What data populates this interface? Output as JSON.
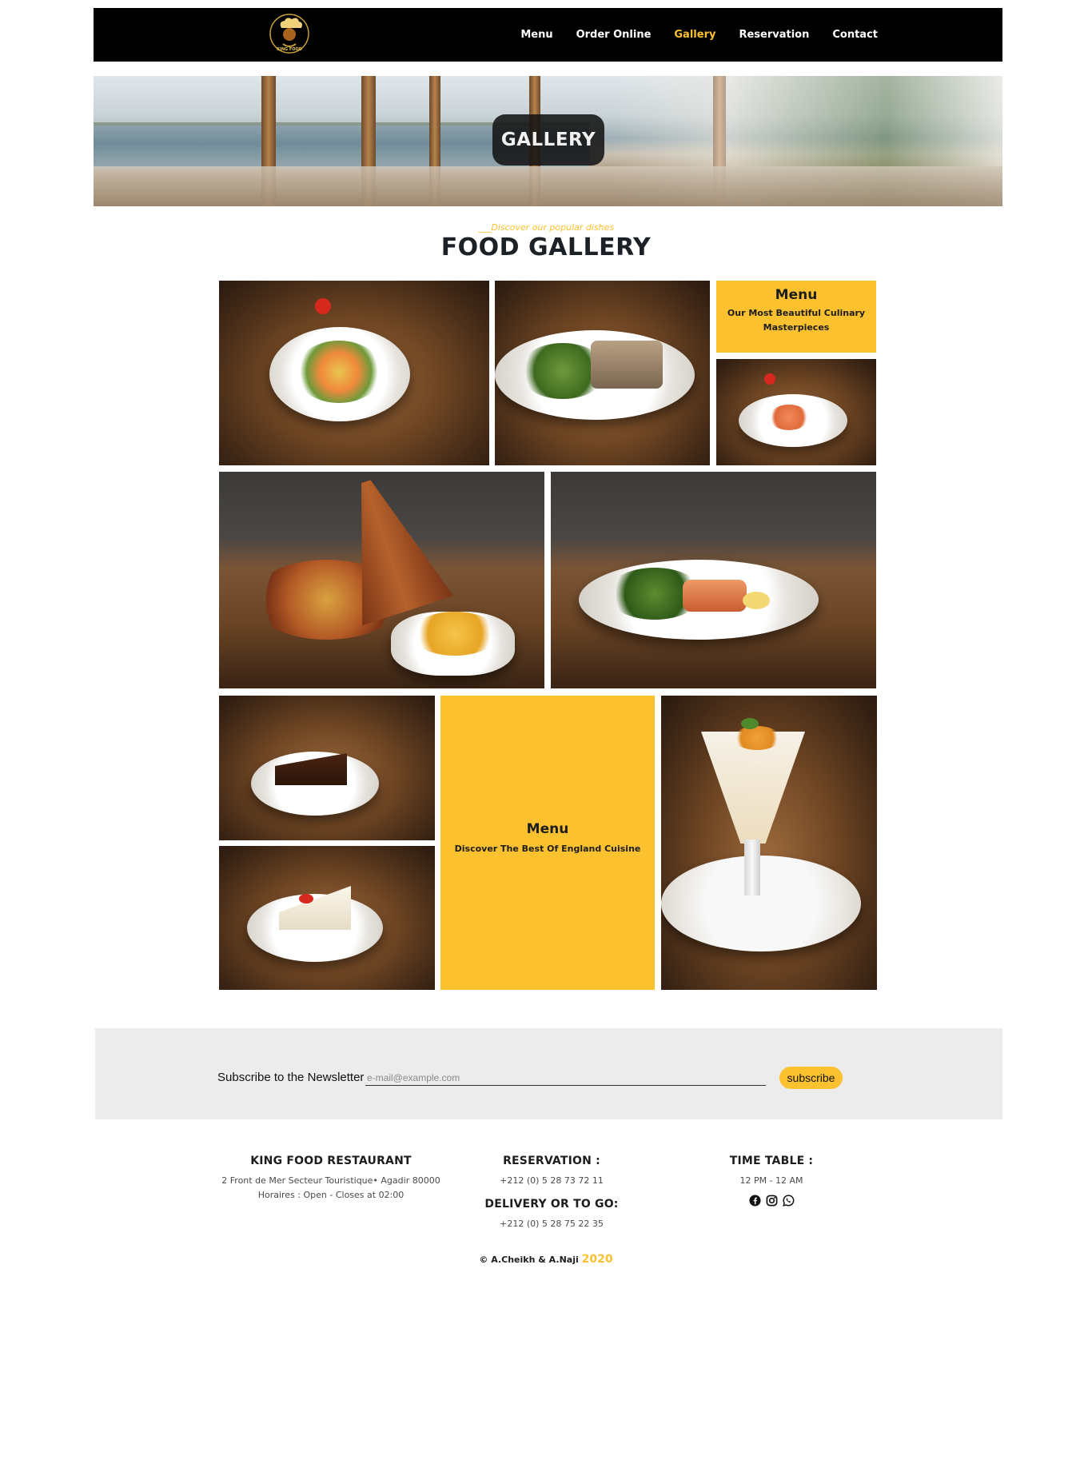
{
  "navbar": {
    "logo_text": "KING FOOD",
    "items": [
      {
        "label": "Menu",
        "active": false
      },
      {
        "label": "Order Online",
        "active": false
      },
      {
        "label": "Gallery",
        "active": true
      },
      {
        "label": "Reservation",
        "active": false
      },
      {
        "label": "Contact",
        "active": false
      }
    ]
  },
  "hero": {
    "title": "GALLERY"
  },
  "section": {
    "kicker": "___Discover our popular dishes",
    "title": "FOOD GALLERY"
  },
  "gallery": {
    "card_1": {
      "title": "Menu",
      "subtitle": "Our Most Beautiful Culinary Masterpieces"
    },
    "card_2": {
      "title": "Menu",
      "subtitle": "Discover The Best Of England Cuisine"
    },
    "photos": [
      "salad-plate",
      "fish-salad-plate",
      "salmon-plate",
      "tajine-fries",
      "salmon-vegetables",
      "chocolate-cake",
      "cheesecake",
      "ice-cream-sundae"
    ]
  },
  "newsletter": {
    "label": "Subscribe to the Newsletter",
    "placeholder": "e-mail@example.com",
    "button": "subscribe"
  },
  "footer": {
    "restaurant": {
      "title": "KING FOOD RESTAURANT",
      "address": "2 Front de Mer Secteur Touristique• Agadir 80000",
      "hours": "Horaires : Open - Closes at 02:00"
    },
    "reservation": {
      "title": "RESERVATION :",
      "phone": "+212 (0) 5 28 73 72 11"
    },
    "delivery": {
      "title": "DELIVERY OR TO GO:",
      "phone": "+212 (0) 5 28 75 22 35"
    },
    "timetable": {
      "title": "TIME TABLE :",
      "hours": "12 PM - 12 AM"
    },
    "socials": [
      "facebook-icon",
      "instagram-icon",
      "whatsapp-icon"
    ],
    "copyright": "© A.Cheikh & A.Naji",
    "year": "2020"
  },
  "colors": {
    "accent": "#fcc12f",
    "nav_bg": "#000000",
    "newsletter_bg": "#ececec"
  }
}
